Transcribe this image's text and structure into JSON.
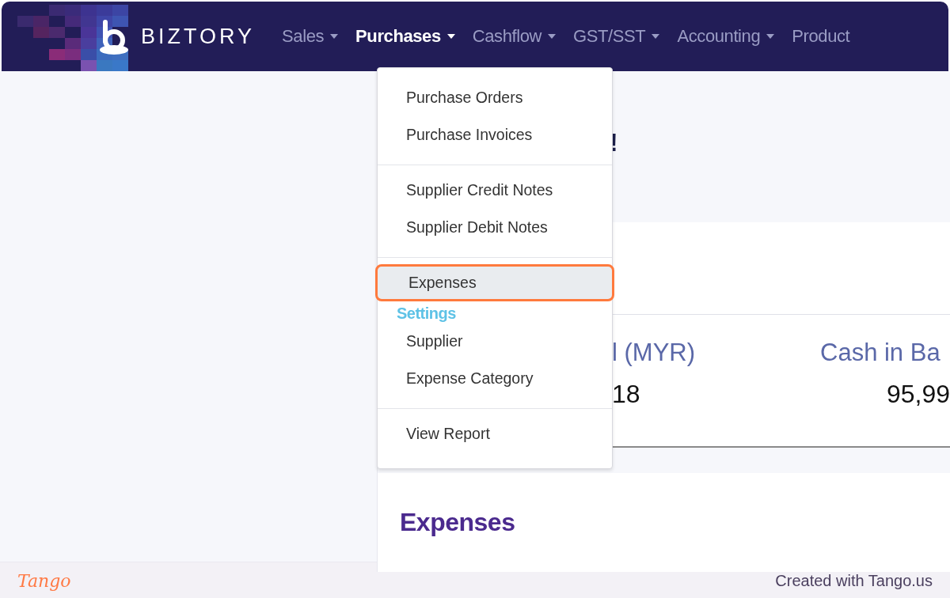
{
  "navbar": {
    "brand": "BIZTORY",
    "items": [
      {
        "label": "Sales",
        "selected": false,
        "caret": true
      },
      {
        "label": "Purchases",
        "selected": true,
        "caret": true
      },
      {
        "label": "Cashflow",
        "selected": false,
        "caret": true
      },
      {
        "label": "GST/SST",
        "selected": false,
        "caret": true
      },
      {
        "label": "Accounting",
        "selected": false,
        "caret": true
      },
      {
        "label": "Product",
        "selected": false,
        "caret": false
      }
    ]
  },
  "dropdown": {
    "groups": [
      {
        "items": [
          {
            "kind": "item",
            "label": "Purchase Orders",
            "highlighted": false
          },
          {
            "kind": "item",
            "label": "Purchase Invoices",
            "highlighted": false
          }
        ]
      },
      {
        "items": [
          {
            "kind": "item",
            "label": "Supplier Credit Notes",
            "highlighted": false
          },
          {
            "kind": "item",
            "label": "Supplier Debit Notes",
            "highlighted": false
          }
        ]
      },
      {
        "items": [
          {
            "kind": "item",
            "label": "Expenses",
            "highlighted": true
          },
          {
            "kind": "header",
            "label": "Settings"
          },
          {
            "kind": "item",
            "label": "Supplier",
            "highlighted": false
          },
          {
            "kind": "item",
            "label": "Expense Category",
            "highlighted": false
          }
        ]
      },
      {
        "items": [
          {
            "kind": "item",
            "label": "View Report",
            "highlighted": false
          }
        ]
      }
    ]
  },
  "page": {
    "heading_fragment": "!",
    "stats": [
      {
        "label": "l (MYR)",
        "value": "18"
      },
      {
        "label": "Cash in Ba",
        "value": "95,99"
      }
    ],
    "section_title": "Expenses"
  },
  "footer": {
    "logo": "Tango",
    "credit": "Created with Tango.us"
  }
}
